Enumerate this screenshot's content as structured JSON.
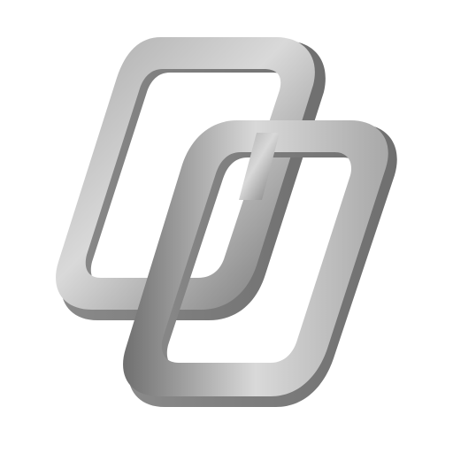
{
  "icon": {
    "name": "interlocking-chain-links-icon",
    "description_visible_text": "",
    "colors": {
      "background": "#ffffff",
      "metal_light": "#d9d9d9",
      "metal_mid": "#a8a8a8",
      "metal_dark": "#6f6f6f",
      "metal_shadow": "#8a8a8a"
    }
  }
}
